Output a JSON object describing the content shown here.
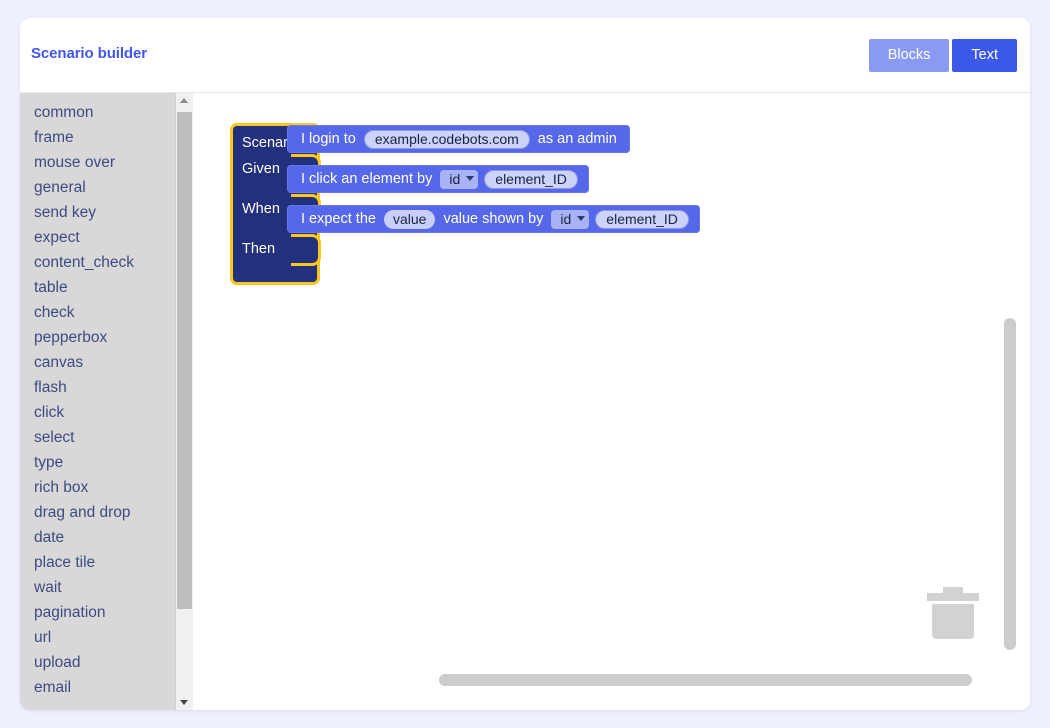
{
  "header": {
    "title": "Scenario builder",
    "modes": [
      {
        "label": "Blocks",
        "active": false
      },
      {
        "label": "Text",
        "active": true
      }
    ]
  },
  "toolbox": {
    "items": [
      {
        "label": "common"
      },
      {
        "label": "frame"
      },
      {
        "label": "mouse over"
      },
      {
        "label": "general"
      },
      {
        "label": "send key"
      },
      {
        "label": "expect"
      },
      {
        "label": "content_check"
      },
      {
        "label": "table"
      },
      {
        "label": "check"
      },
      {
        "label": "pepperbox"
      },
      {
        "label": "canvas"
      },
      {
        "label": "flash"
      },
      {
        "label": "click"
      },
      {
        "label": "select"
      },
      {
        "label": "type"
      },
      {
        "label": "rich box"
      },
      {
        "label": "drag and drop"
      },
      {
        "label": "date"
      },
      {
        "label": "place tile"
      },
      {
        "label": "wait"
      },
      {
        "label": "pagination"
      },
      {
        "label": "url"
      },
      {
        "label": "upload"
      },
      {
        "label": "email"
      }
    ]
  },
  "workspace": {
    "scenario": {
      "title": "Scenario:",
      "rows": [
        {
          "keyword": "Given"
        },
        {
          "keyword": "When"
        },
        {
          "keyword": "Then"
        }
      ]
    },
    "statements": {
      "given": {
        "text1": "I login to",
        "field_url": "example.codebots.com",
        "text2": "as an admin"
      },
      "when": {
        "text1": "I click an element by",
        "field_selector": "id",
        "field_value": "element_ID"
      },
      "then": {
        "text1": "I expect the",
        "field_attribute": "value",
        "text2": "value shown by",
        "field_selector": "id",
        "field_value": "element_ID"
      }
    },
    "trash_icon": "trash-can-icon"
  },
  "colors": {
    "page_background": "#eef0fd",
    "brand": "#4355f0",
    "mode_active": "#3b58e8",
    "mode_inactive": "#8a99f2",
    "scenario_block": "#22307d",
    "scenario_border": "#ffc61e",
    "statement_block": "#5668ea",
    "toolbox_background": "#d8d8d8",
    "toolbox_text": "#3d4b82"
  }
}
